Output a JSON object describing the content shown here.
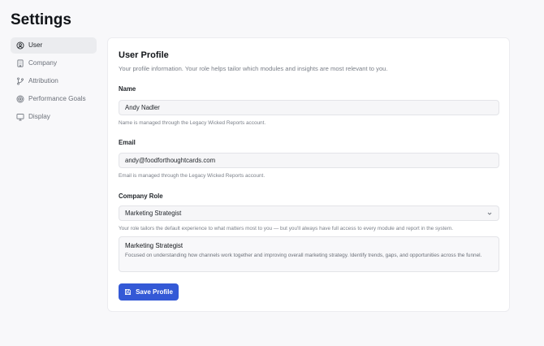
{
  "page": {
    "title": "Settings"
  },
  "sidebar": {
    "items": [
      {
        "label": "User",
        "icon": "user-circle-icon",
        "active": true
      },
      {
        "label": "Company",
        "icon": "building-icon",
        "active": false
      },
      {
        "label": "Attribution",
        "icon": "git-branch-icon",
        "active": false
      },
      {
        "label": "Performance Goals",
        "icon": "target-icon",
        "active": false
      },
      {
        "label": "Display",
        "icon": "monitor-icon",
        "active": false
      }
    ]
  },
  "profile": {
    "title": "User Profile",
    "subtitle": "Your profile information. Your role helps tailor which modules and insights are most relevant to you.",
    "name": {
      "label": "Name",
      "value": "Andy Nadler",
      "help": "Name is managed through the Legacy Wicked Reports account."
    },
    "email": {
      "label": "Email",
      "value": "andy@foodforthoughtcards.com",
      "help": "Email is managed through the Legacy Wicked Reports account."
    },
    "role": {
      "label": "Company Role",
      "value": "Marketing Strategist",
      "help": "Your role tailors the default experience to what matters most to you — but you'll always have full access to every module and report in the system.",
      "card_title": "Marketing Strategist",
      "card_description": "Focused on understanding how channels work together and improving overall marketing strategy. Identify trends, gaps, and opportunities across the funnel."
    },
    "save_label": "Save Profile"
  },
  "colors": {
    "accent": "#3459d6",
    "background": "#f8f8fa",
    "card": "#ffffff"
  }
}
